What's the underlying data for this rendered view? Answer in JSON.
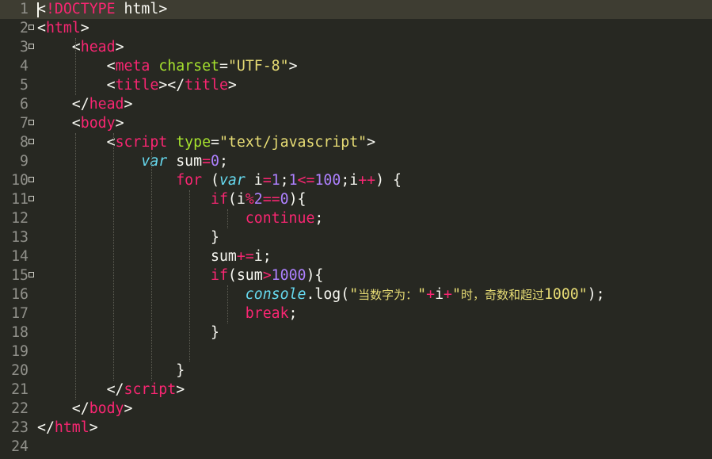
{
  "editor": {
    "theme": "Monokai",
    "colors": {
      "background": "#272822",
      "current_line": "#3e3d32",
      "line_number": "#90908a",
      "plain": "#f8f8f2",
      "tag": "#f92672",
      "attribute": "#a6e22e",
      "string": "#e6db74",
      "storage": "#66d9ef",
      "number": "#ae81ff"
    },
    "current_line": 1,
    "lines": [
      {
        "n": "1",
        "fold": false,
        "tokens": [
          [
            "p",
            "<"
          ],
          [
            "t",
            "!DOCTYPE"
          ],
          [
            "p",
            " "
          ],
          [
            "p",
            "html"
          ],
          [
            "p",
            ">"
          ]
        ]
      },
      {
        "n": "2",
        "fold": true,
        "tokens": [
          [
            "p",
            "<"
          ],
          [
            "t",
            "html"
          ],
          [
            "p",
            ">"
          ]
        ]
      },
      {
        "n": "3",
        "fold": true,
        "tokens": [
          [
            "p",
            "    <"
          ],
          [
            "t",
            "head"
          ],
          [
            "p",
            ">"
          ]
        ]
      },
      {
        "n": "4",
        "fold": false,
        "tokens": [
          [
            "p",
            "        <"
          ],
          [
            "t",
            "meta"
          ],
          [
            "p",
            " "
          ],
          [
            "a",
            "charset"
          ],
          [
            "p",
            "="
          ],
          [
            "s",
            "\"UTF-8\""
          ],
          [
            "p",
            ">"
          ]
        ]
      },
      {
        "n": "5",
        "fold": false,
        "tokens": [
          [
            "p",
            "        <"
          ],
          [
            "t",
            "title"
          ],
          [
            "p",
            "></"
          ],
          [
            "t",
            "title"
          ],
          [
            "p",
            ">"
          ]
        ]
      },
      {
        "n": "6",
        "fold": false,
        "tokens": [
          [
            "p",
            "    </"
          ],
          [
            "t",
            "head"
          ],
          [
            "p",
            ">"
          ]
        ]
      },
      {
        "n": "7",
        "fold": true,
        "tokens": [
          [
            "p",
            "    <"
          ],
          [
            "t",
            "body"
          ],
          [
            "p",
            ">"
          ]
        ]
      },
      {
        "n": "8",
        "fold": true,
        "tokens": [
          [
            "p",
            "        <"
          ],
          [
            "t",
            "script"
          ],
          [
            "p",
            " "
          ],
          [
            "a",
            "type"
          ],
          [
            "p",
            "="
          ],
          [
            "s",
            "\"text/javascript\""
          ],
          [
            "p",
            ">"
          ]
        ]
      },
      {
        "n": "9",
        "fold": false,
        "tokens": [
          [
            "p",
            "            "
          ],
          [
            "k",
            "var"
          ],
          [
            "p",
            " sum"
          ],
          [
            "o",
            "="
          ],
          [
            "n",
            "0"
          ],
          [
            "p",
            ";"
          ]
        ]
      },
      {
        "n": "10",
        "fold": true,
        "tokens": [
          [
            "p",
            "                "
          ],
          [
            "kw",
            "for"
          ],
          [
            "p",
            " ("
          ],
          [
            "k",
            "var"
          ],
          [
            "p",
            " i"
          ],
          [
            "o",
            "="
          ],
          [
            "n",
            "1"
          ],
          [
            "p",
            ";"
          ],
          [
            "n",
            "1"
          ],
          [
            "o",
            "<="
          ],
          [
            "n",
            "100"
          ],
          [
            "p",
            ";i"
          ],
          [
            "o",
            "++"
          ],
          [
            "p",
            ") {"
          ]
        ]
      },
      {
        "n": "11",
        "fold": true,
        "tokens": [
          [
            "p",
            "                    "
          ],
          [
            "kw",
            "if"
          ],
          [
            "p",
            "(i"
          ],
          [
            "o",
            "%"
          ],
          [
            "n",
            "2"
          ],
          [
            "o",
            "=="
          ],
          [
            "n",
            "0"
          ],
          [
            "p",
            "){"
          ]
        ]
      },
      {
        "n": "12",
        "fold": false,
        "tokens": [
          [
            "p",
            "                        "
          ],
          [
            "kw",
            "continue"
          ],
          [
            "p",
            ";"
          ]
        ]
      },
      {
        "n": "13",
        "fold": false,
        "tokens": [
          [
            "p",
            "                    }"
          ]
        ]
      },
      {
        "n": "14",
        "fold": false,
        "tokens": [
          [
            "p",
            "                    sum"
          ],
          [
            "o",
            "+="
          ],
          [
            "p",
            "i;"
          ]
        ]
      },
      {
        "n": "15",
        "fold": true,
        "tokens": [
          [
            "p",
            "                    "
          ],
          [
            "kw",
            "if"
          ],
          [
            "p",
            "(sum"
          ],
          [
            "o",
            ">"
          ],
          [
            "n",
            "1000"
          ],
          [
            "p",
            "){"
          ]
        ]
      },
      {
        "n": "16",
        "fold": false,
        "tokens": [
          [
            "p",
            "                        "
          ],
          [
            "k",
            "console"
          ],
          [
            "p",
            ".log("
          ],
          [
            "s",
            "\""
          ],
          [
            "scjk",
            "当数字为："
          ],
          [
            "s",
            "\""
          ],
          [
            "o",
            "+"
          ],
          [
            "p",
            "i"
          ],
          [
            "o",
            "+"
          ],
          [
            "s",
            "\""
          ],
          [
            "scjk",
            "时，奇数和超过"
          ],
          [
            "s",
            "1000\""
          ],
          [
            "p",
            ");"
          ]
        ]
      },
      {
        "n": "17",
        "fold": false,
        "tokens": [
          [
            "p",
            "                        "
          ],
          [
            "kw",
            "break"
          ],
          [
            "p",
            ";"
          ]
        ]
      },
      {
        "n": "18",
        "fold": false,
        "tokens": [
          [
            "p",
            "                    }"
          ]
        ]
      },
      {
        "n": "19",
        "fold": false,
        "tokens": []
      },
      {
        "n": "20",
        "fold": false,
        "tokens": [
          [
            "p",
            "                }"
          ]
        ]
      },
      {
        "n": "21",
        "fold": false,
        "tokens": [
          [
            "p",
            "        </"
          ],
          [
            "t",
            "script"
          ],
          [
            "p",
            ">"
          ]
        ]
      },
      {
        "n": "22",
        "fold": false,
        "tokens": [
          [
            "p",
            "    </"
          ],
          [
            "t",
            "body"
          ],
          [
            "p",
            ">"
          ]
        ]
      },
      {
        "n": "23",
        "fold": false,
        "tokens": [
          [
            "p",
            "</"
          ],
          [
            "t",
            "html"
          ],
          [
            "p",
            ">"
          ]
        ]
      },
      {
        "n": "24",
        "fold": false,
        "tokens": []
      }
    ]
  }
}
